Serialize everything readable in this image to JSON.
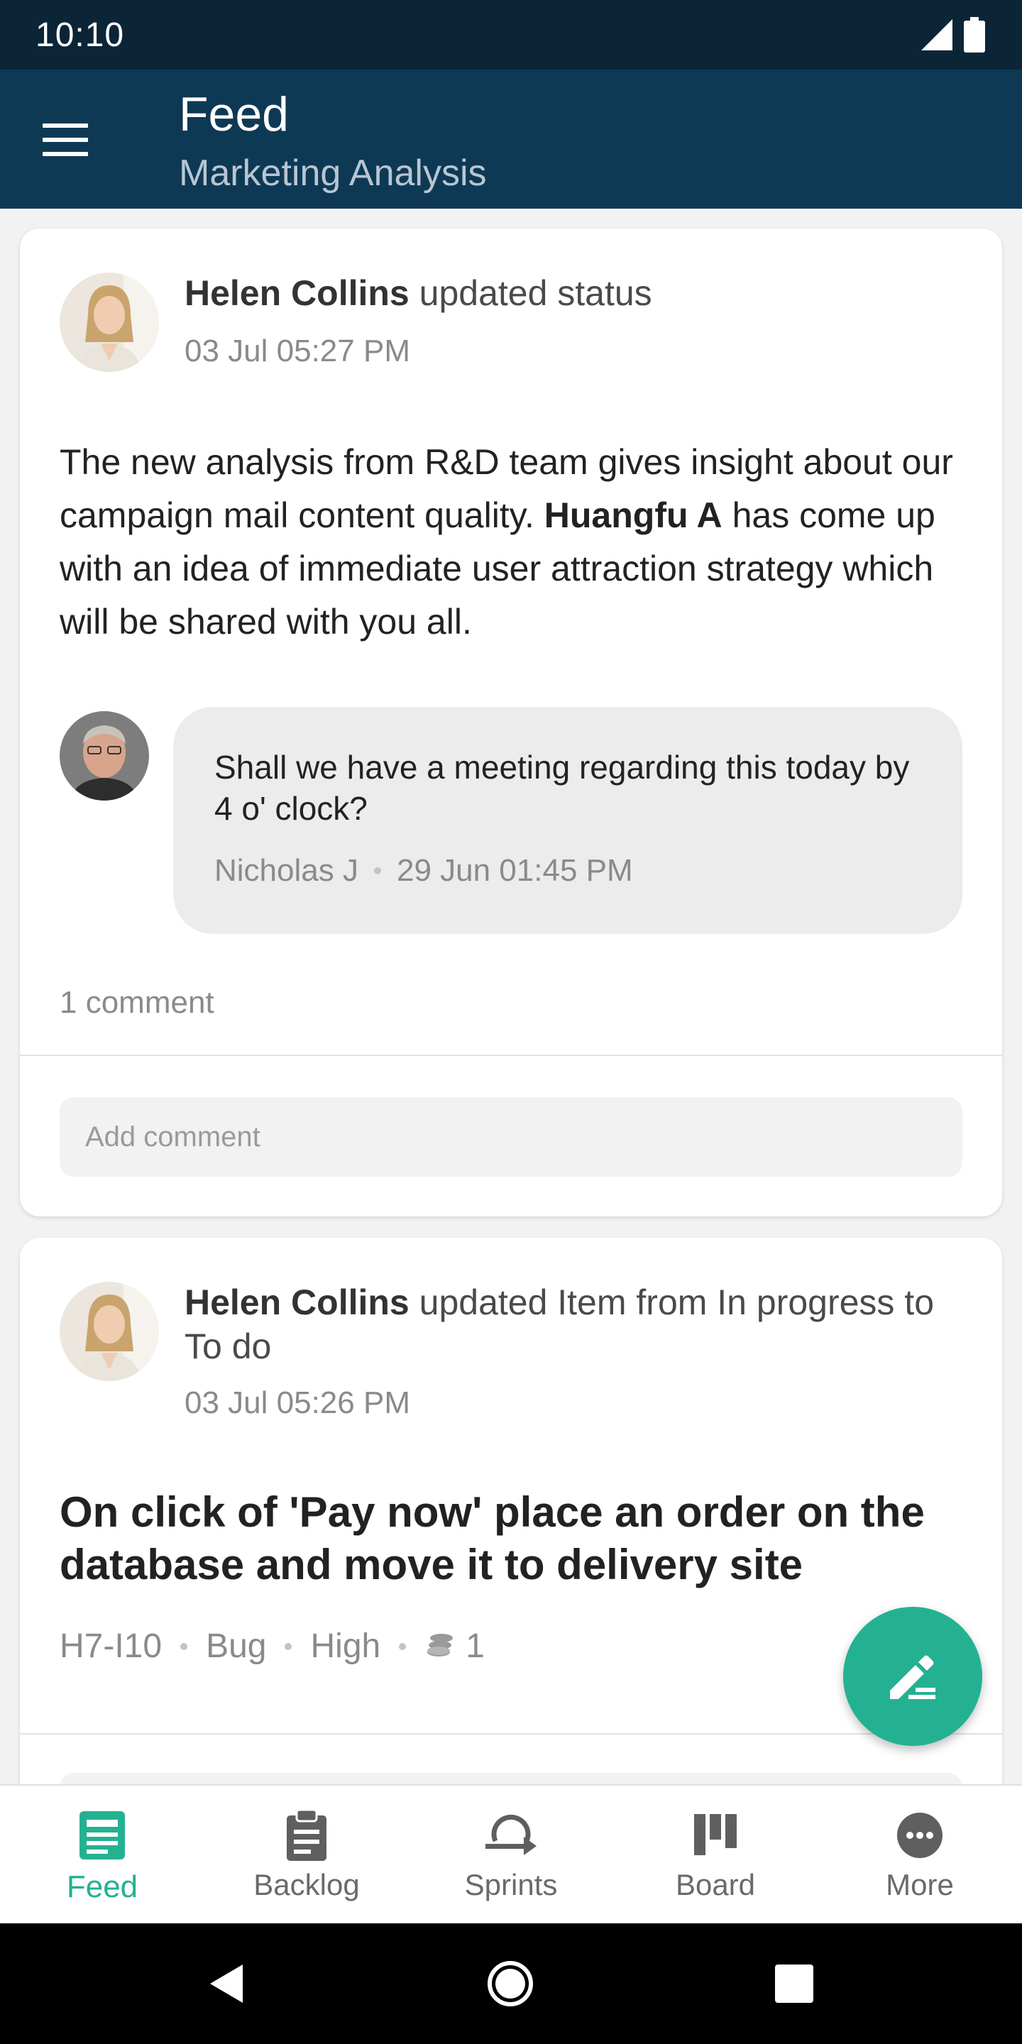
{
  "status_bar": {
    "time": "10:10"
  },
  "app_bar": {
    "title": "Feed",
    "subtitle": "Marketing Analysis"
  },
  "feed": {
    "post1": {
      "author": "Helen Collins",
      "action": "updated status",
      "time": "03 Jul 05:27 PM",
      "body_pre": "The new analysis from R&D team gives insight about our campaign mail content quality.",
      "body_mention": "Huangfu A",
      "body_post": "has come up with an idea of immediate user attraction strategy which will be shared with you all.",
      "comment": {
        "text": "Shall we have a meeting regarding this today by 4 o' clock?",
        "author": "Nicholas J",
        "time": "29 Jun 01:45 PM"
      },
      "comment_count": "1 comment",
      "add_comment_placeholder": "Add comment"
    },
    "post2": {
      "author": "Helen Collins",
      "action": "updated Item from In progress to To do",
      "time": "03 Jul 05:26 PM",
      "item_title": "On click of 'Pay now' place an order on the database and move it to delivery site",
      "item_id": "H7-I10",
      "item_type": "Bug",
      "priority": "High",
      "points": "1"
    }
  },
  "bottom_nav": {
    "feed": "Feed",
    "backlog": "Backlog",
    "sprints": "Sprints",
    "board": "Board",
    "more": "More"
  },
  "colors": {
    "status_bar": "#0b2537",
    "app_bar": "#0e3955",
    "accent": "#24b192",
    "background": "#f2f2f2"
  },
  "icons": {
    "menu": "hamburger-icon",
    "fab": "edit-icon",
    "feed": "feed-icon",
    "backlog": "clipboard-icon",
    "sprints": "sprint-icon",
    "board": "board-icon",
    "more": "more-icon"
  }
}
